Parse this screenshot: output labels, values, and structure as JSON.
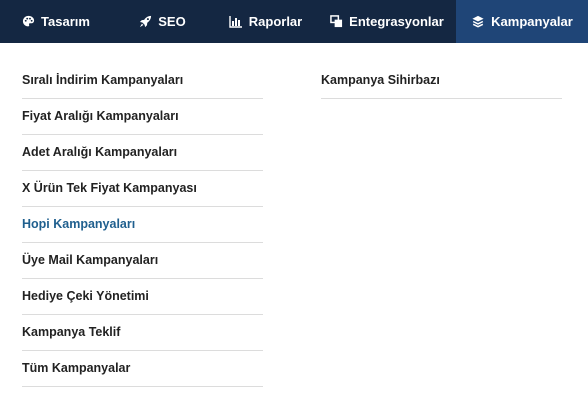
{
  "nav": {
    "items": [
      {
        "label": "Tasarım",
        "icon": "palette-icon"
      },
      {
        "label": "SEO",
        "icon": "rocket-icon"
      },
      {
        "label": "Raporlar",
        "icon": "bar-chart-icon"
      },
      {
        "label": "Entegrasyonlar",
        "icon": "windows-stack-icon"
      },
      {
        "label": "Kampanyalar",
        "icon": "layers-icon",
        "active": true
      }
    ],
    "background": "#142742",
    "active_background": "#1f4577"
  },
  "menu": {
    "left": [
      "Sıralı İndirim Kampanyaları",
      "Fiyat Aralığı Kampanyaları",
      "Adet Aralığı Kampanyaları",
      "X Ürün Tek Fiyat Kampanyası",
      "Hopi Kampanyaları",
      "Üye Mail Kampanyaları",
      "Hediye Çeki Yönetimi",
      "Kampanya Teklif",
      "Tüm Kampanyalar"
    ],
    "right": [
      "Kampanya Sihirbazı"
    ],
    "highlighted": "Hopi Kampanyaları",
    "highlight_color": "#1f5f8e"
  }
}
